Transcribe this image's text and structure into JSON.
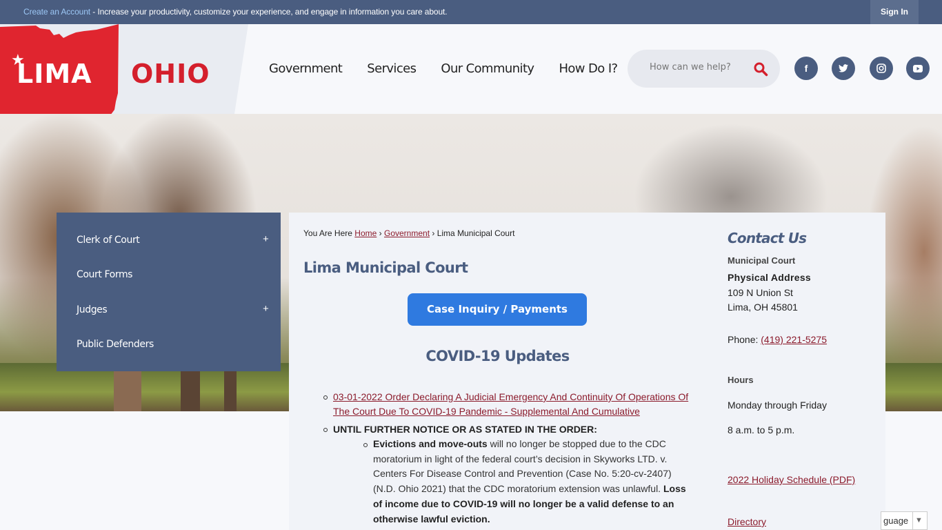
{
  "topbar": {
    "create_account": "Create an Account",
    "message": " - Increase your productivity, customize your experience, and engage in information you care about.",
    "sign_in": "Sign In"
  },
  "logo": {
    "lima": "LIMA",
    "ohio": "OHIO",
    "star": "★"
  },
  "nav": {
    "items": [
      "Government",
      "Services",
      "Our Community",
      "How Do I?"
    ]
  },
  "search": {
    "placeholder": "How can we help?",
    "icon": "search-icon"
  },
  "social": [
    {
      "name": "facebook",
      "glyph": "f"
    },
    {
      "name": "twitter",
      "glyph": "t"
    },
    {
      "name": "instagram",
      "glyph": "◎"
    },
    {
      "name": "youtube",
      "glyph": "▶"
    }
  ],
  "sidenav": {
    "items": [
      {
        "label": "Clerk of Court",
        "expand": "+"
      },
      {
        "label": "Court Forms",
        "expand": ""
      },
      {
        "label": "Judges",
        "expand": "+"
      },
      {
        "label": "Public Defenders",
        "expand": ""
      }
    ]
  },
  "breadcrumb": {
    "prefix": "You Are Here",
    "items": [
      "Home",
      "Government",
      "Lima Municipal Court"
    ],
    "separator": "›"
  },
  "main": {
    "title": "Lima Municipal Court",
    "case_button": "Case Inquiry / Payments",
    "covid_title": "COVID-19 Updates",
    "order_link": "03-01-2022 Order Declaring A Judicial Emergency And Continuity Of Operations Of The Court Due To COVID-19 Pandemic - Supplemental And Cumulative",
    "until_notice": "UNTIL FURTHER NOTICE OR AS STATED IN THE ORDER:",
    "evictions_bold": "Evictions and move-outs",
    "evictions_text": " will no longer be stopped due to the CDC moratorium in light of the federal court’s decision in Skyworks LTD. v. Centers For Disease Control and Prevention (Case No. 5:20-cv-2407) (N.D. Ohio 2021) that the CDC moratorium extension was unlawful. ",
    "evictions_bold2": "Loss of income due to COVID-19 will no longer be a valid defense to an otherwise lawful eviction."
  },
  "contact": {
    "title": "Contact Us",
    "department": "Municipal Court",
    "address_label": "Physical Address",
    "street": "109 N Union St",
    "city": "Lima, OH 45801",
    "phone_label": "Phone: ",
    "phone": "(419) 221-5275",
    "hours_label": "Hours",
    "days": "Monday through Friday",
    "time": "8 a.m. to 5 p.m.",
    "holiday_link": "2022 Holiday Schedule (PDF)",
    "directory_link": "Directory"
  },
  "language": {
    "label": "Select Language",
    "visible": "guage",
    "arrow": "▼"
  },
  "colors": {
    "brand_navy": "#4a5d80",
    "brand_red": "#d41f2c",
    "button_blue": "#2f7ae0",
    "link_maroon": "#8b1a2b"
  }
}
